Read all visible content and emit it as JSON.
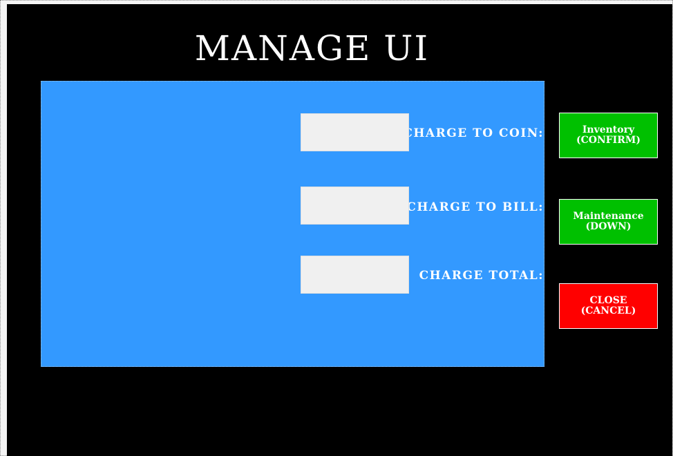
{
  "title": "MANAGE UI",
  "form": {
    "rows": [
      {
        "label": "CHARGE TO COIN:",
        "value": "",
        "placeholder": ""
      },
      {
        "label": "CHARGE TO BILL:",
        "value": "",
        "placeholder": ""
      },
      {
        "label": "CHARGE TOTAL:",
        "value": "",
        "placeholder": ""
      }
    ]
  },
  "buttons": {
    "inventory": {
      "line1": "Inventory",
      "line2": "(CONFIRM)"
    },
    "maintenance": {
      "line1": "Maintenance",
      "line2": "(DOWN)"
    },
    "close": {
      "line1": "CLOSE",
      "line2": "(CANCEL)"
    }
  },
  "colors": {
    "screen_background": "#000000",
    "panel": "#3399ff",
    "field": "#f0f0f0",
    "inventory_button": "#00c000",
    "maintenance_button": "#00c000",
    "close_button": "#ff0000"
  }
}
